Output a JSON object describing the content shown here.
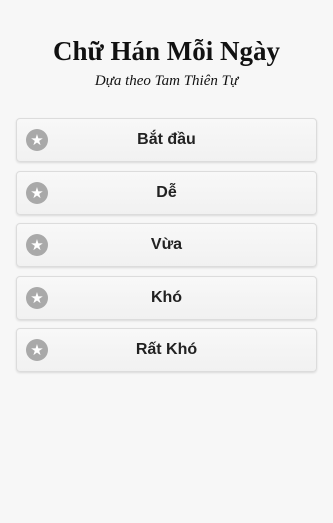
{
  "header": {
    "title": "Chữ Hán Mỗi Ngày",
    "subtitle": "Dựa theo Tam Thiên Tự"
  },
  "menu": {
    "items": [
      {
        "label": "Bắt đầu",
        "icon": "star-icon"
      },
      {
        "label": "Dễ",
        "icon": "star-icon"
      },
      {
        "label": "Vừa",
        "icon": "star-icon"
      },
      {
        "label": "Khó",
        "icon": "star-icon"
      },
      {
        "label": "Rất Khó",
        "icon": "star-icon"
      }
    ]
  },
  "colors": {
    "background": "#f7f7f7",
    "button_background": "#f5f5f5",
    "button_border": "#dcdcdc",
    "icon_circle": "#a9a9a9",
    "text": "#222222"
  }
}
